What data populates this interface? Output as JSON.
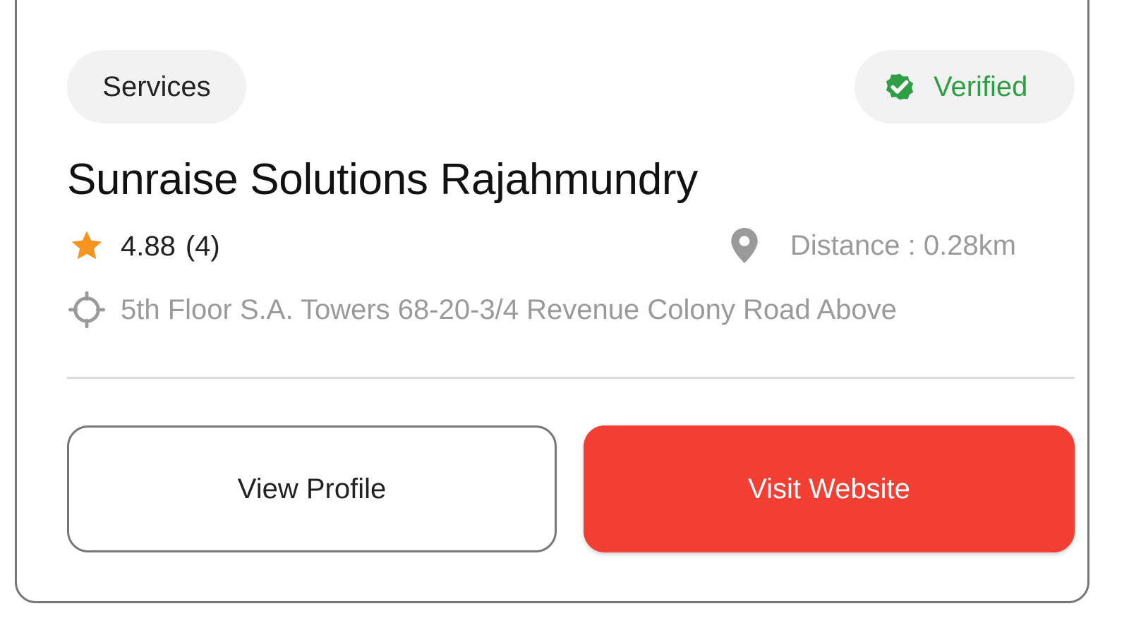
{
  "listing": {
    "category": "Services",
    "verified_label": "Verified",
    "name": "Sunraise Solutions Rajahmundry",
    "rating": "4.88",
    "rating_count": "(4)",
    "distance": "Distance : 0.28km",
    "address": "5th Floor S.A. Towers 68-20-3/4 Revenue Colony Road Above"
  },
  "actions": {
    "view_profile": "View Profile",
    "visit_website": "Visit Website"
  },
  "icons": {
    "verified": "verified-badge-icon",
    "rating": "star-icon",
    "distance": "map-pin-icon",
    "address": "location-target-icon"
  },
  "colors": {
    "verified": "#2f9e44",
    "star": "#f7931e",
    "primary": "#f23e33",
    "muted_text": "#9a9a9a"
  }
}
